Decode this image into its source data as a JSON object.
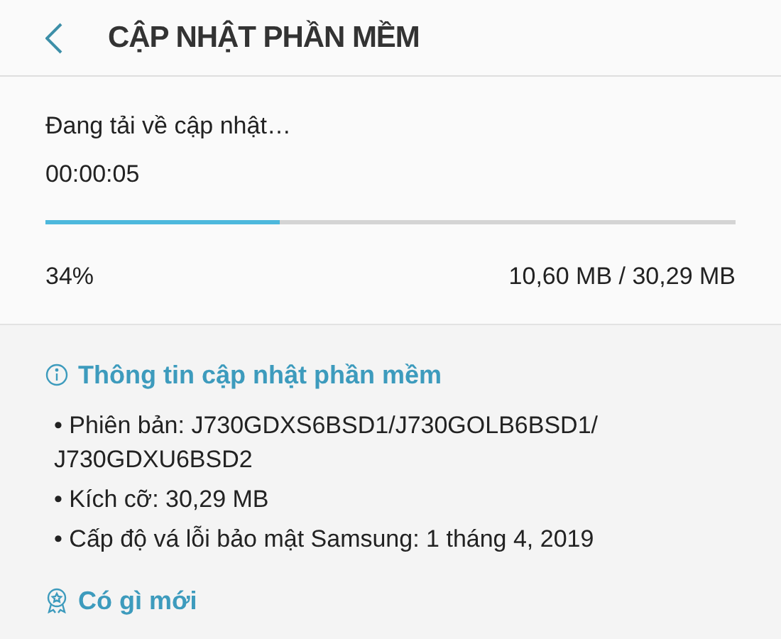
{
  "header": {
    "title": "CẬP NHẬT PHẦN MỀM"
  },
  "download": {
    "status": "Đang tải về cập nhật…",
    "elapsed": "00:00:05",
    "level": 0.34,
    "percent": "34%",
    "size": "10,60 MB / 30,29 MB"
  },
  "sections": [
    {
      "kind": "info",
      "title": "Thông tin cập nhật phần mềm",
      "lines": [
        "• Phiên bản: J730GDXS6BSD1/J730GOLB6BSD1/ J730GDXU6BSD2",
        "• Kích cỡ: 30,29 MB",
        "• Cấp độ vá lỗi bảo mật Samsung: 1 tháng 4, 2019"
      ]
    },
    {
      "kind": "news",
      "title": "Có gì mới"
    }
  ]
}
